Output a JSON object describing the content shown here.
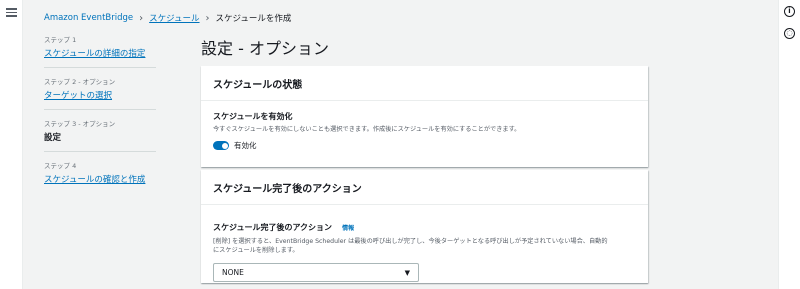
{
  "breadcrumb": {
    "items": [
      "Amazon EventBridge",
      "スケジュール"
    ],
    "current": "スケジュールを作成"
  },
  "steps": [
    {
      "num": "ステップ 1",
      "title": "スケジュールの詳細の指定"
    },
    {
      "num": "ステップ 2 - オプション",
      "title": "ターゲットの選択"
    },
    {
      "num": "ステップ 3 - オプション",
      "title": "設定"
    },
    {
      "num": "ステップ 4",
      "title": "スケジュールの確認と作成"
    }
  ],
  "page": {
    "title": "設定 - オプション"
  },
  "schedule_state": {
    "header": "スケジュールの状態",
    "label": "スケジュールを有効化",
    "description": "今すぐスケジュールを有効にしないことも選択できます。作成後にスケジュールを有効にすることができます。",
    "toggle_label": "有効化",
    "enabled": true
  },
  "completion_action": {
    "header": "スケジュール完了後のアクション",
    "label": "スケジュール完了後のアクション",
    "info": "情報",
    "description_line1": "[削除] を選択すると、EventBridge Scheduler は最後の呼び出しが完了し、今後ターゲットとなる呼び出しが予定されていない場合、自動的",
    "description_line2": "にスケジュールを削除します。",
    "selected": "NONE"
  },
  "colors": {
    "link": "#0073bb",
    "toggle_on": "#0073bb",
    "background": "#f2f3f3"
  },
  "icons": {
    "menu": "hamburger-icon",
    "info": "info-icon",
    "settings": "gear-icon"
  }
}
